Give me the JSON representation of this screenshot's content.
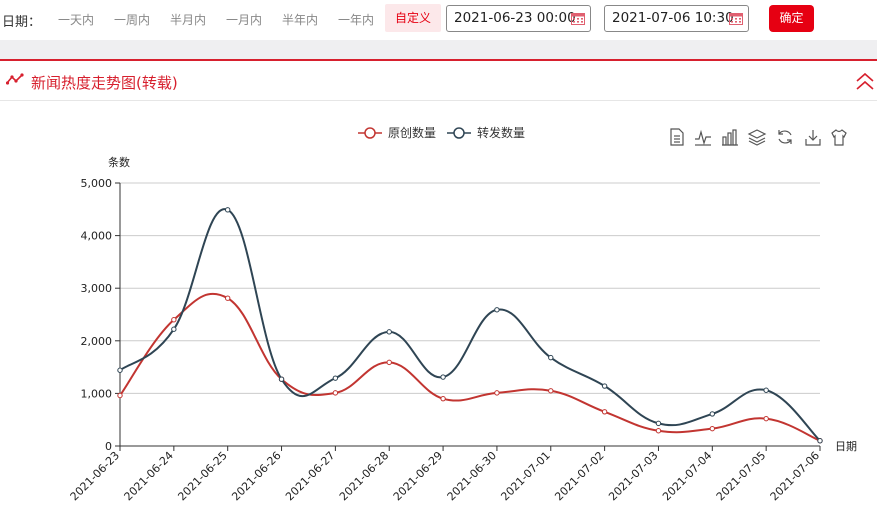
{
  "filter": {
    "label": "日期：",
    "ranges": [
      "一天内",
      "一周内",
      "半月内",
      "一月内",
      "半年内",
      "一年内",
      "自定义"
    ],
    "active_range": "自定义",
    "start_date": "2021-06-23 00:00",
    "end_date": "2021-07-06 10:30",
    "confirm_label": "确定"
  },
  "panel": {
    "title": "新闻热度走势图(转载)"
  },
  "colors": {
    "accent": "#e60012",
    "series_original": "#c23531",
    "series_forward": "#2f4554"
  },
  "toolbox": [
    "data-view-icon",
    "line-chart-icon",
    "bar-chart-icon",
    "stack-icon",
    "refresh-icon",
    "download-icon",
    "theme-icon"
  ],
  "chart_data": {
    "type": "line",
    "smooth": true,
    "ylabel": "条数",
    "xlabel": "日期",
    "ylim": [
      0,
      5000
    ],
    "yticks": [
      "0",
      "1,000",
      "2,000",
      "3,000",
      "4,000",
      "5,000"
    ],
    "grid": true,
    "legend_position": "top-center",
    "categories": [
      "2021-06-23",
      "2021-06-24",
      "2021-06-25",
      "2021-06-26",
      "2021-06-27",
      "2021-06-28",
      "2021-06-29",
      "2021-06-30",
      "2021-07-01",
      "2021-07-02",
      "2021-07-03",
      "2021-07-04",
      "2021-07-05",
      "2021-07-06"
    ],
    "series": [
      {
        "name": "原创数量",
        "values": [
          960,
          2400,
          2810,
          1270,
          1010,
          1590,
          900,
          1010,
          1050,
          650,
          290,
          330,
          520,
          100
        ]
      },
      {
        "name": "转发数量",
        "values": [
          1440,
          2220,
          4490,
          1270,
          1290,
          2170,
          1310,
          2590,
          1680,
          1140,
          430,
          610,
          1060,
          100
        ]
      }
    ]
  }
}
